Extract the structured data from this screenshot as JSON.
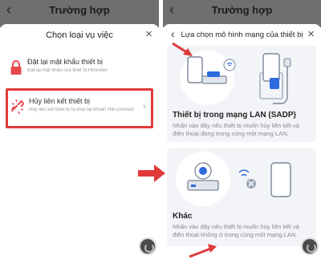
{
  "left": {
    "header": {
      "back_icon": "chevron-left-icon",
      "title": "Trường hợp"
    },
    "sheet": {
      "title": "Chọn loại vụ việc",
      "close_icon": "close-icon",
      "items": [
        {
          "label": "Đặt lại mật khẩu thiết bị",
          "subtitle": "Đặt lại mật khẩu của thiết bị Hikvision",
          "icon": "lock-icon",
          "icon_color": "#e5484d"
        },
        {
          "label": "Hủy liên kết thiết bị",
          "subtitle": "Hủy liên kết thiết bị ra khỏi tài khoản Hik-Connect",
          "icon": "unlink-icon",
          "icon_color": "#e5484d",
          "highlighted": true
        }
      ]
    },
    "fab_icon": "support-icon"
  },
  "right": {
    "header": {
      "back_icon": "chevron-left-icon",
      "title": "Trường hợp"
    },
    "sheet": {
      "back_icon": "chevron-left-icon",
      "title": "Lựa chọn mô hình mạng của thiết bị",
      "close_icon": "close-icon",
      "cards": [
        {
          "title": "Thiết bị trong mạng LAN (SADP)",
          "description": "Nhấn vào đây nếu thiết bị muốn hủy liên kết và điện thoại đang trong cùng một mạng LAN."
        },
        {
          "title": "Khác",
          "description": "Nhấn vào đây nếu thiết bị muốn hủy liên kết và điện thoại không ở trong cùng một mạng LAN."
        }
      ]
    },
    "fab_icon": "support-icon"
  },
  "colors": {
    "accent_red": "#e03a3a",
    "overlay": "#6f6f6f",
    "card_bg": "#f2f4f7"
  }
}
